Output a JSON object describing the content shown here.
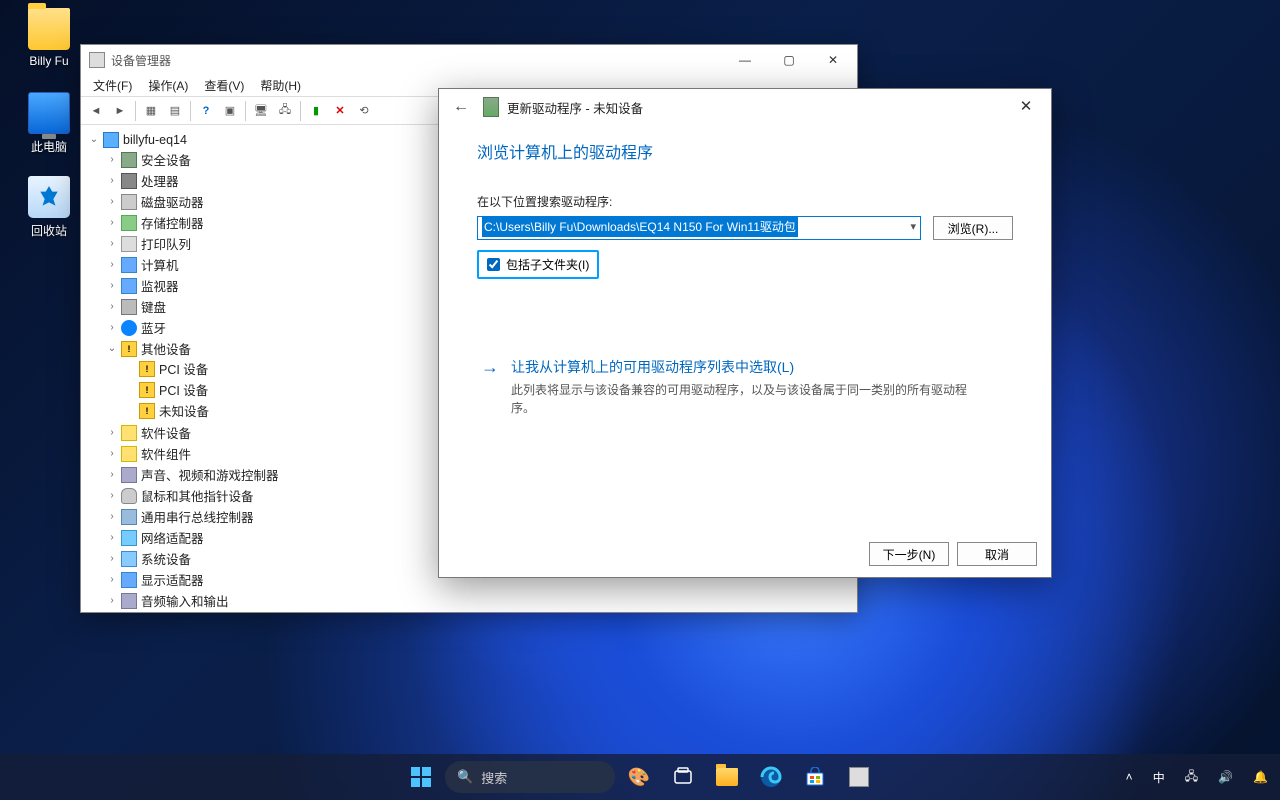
{
  "desktop": {
    "icons": [
      {
        "name": "user-folder",
        "label": "Billy Fu"
      },
      {
        "name": "this-pc",
        "label": "此电脑"
      },
      {
        "name": "recycle-bin",
        "label": "回收站"
      }
    ]
  },
  "devmgr": {
    "title": "设备管理器",
    "menu": [
      "文件(F)",
      "操作(A)",
      "查看(V)",
      "帮助(H)"
    ],
    "root": "billyfu-eq14",
    "nodes": [
      {
        "label": "安全设备",
        "icon": "i-sec"
      },
      {
        "label": "处理器",
        "icon": "i-chip"
      },
      {
        "label": "磁盘驱动器",
        "icon": "i-disk"
      },
      {
        "label": "存储控制器",
        "icon": "i-ctrl"
      },
      {
        "label": "打印队列",
        "icon": "i-print"
      },
      {
        "label": "计算机",
        "icon": "i-mon"
      },
      {
        "label": "监视器",
        "icon": "i-mon"
      },
      {
        "label": "键盘",
        "icon": "i-kb"
      },
      {
        "label": "蓝牙",
        "icon": "i-bt"
      },
      {
        "label": "其他设备",
        "icon": "i-warn",
        "open": true,
        "children": [
          {
            "label": "PCI 设备",
            "icon": "i-warn"
          },
          {
            "label": "PCI 设备",
            "icon": "i-warn"
          },
          {
            "label": "未知设备",
            "icon": "i-warn"
          }
        ]
      },
      {
        "label": "软件设备",
        "icon": "i-unk"
      },
      {
        "label": "软件组件",
        "icon": "i-unk"
      },
      {
        "label": "声音、视频和游戏控制器",
        "icon": "i-snd"
      },
      {
        "label": "鼠标和其他指针设备",
        "icon": "i-mouse"
      },
      {
        "label": "通用串行总线控制器",
        "icon": "i-usb"
      },
      {
        "label": "网络适配器",
        "icon": "i-net"
      },
      {
        "label": "系统设备",
        "icon": "i-sys"
      },
      {
        "label": "显示适配器",
        "icon": "i-mon"
      },
      {
        "label": "音频输入和输出",
        "icon": "i-snd"
      }
    ]
  },
  "wizard": {
    "title": "更新驱动程序 - 未知设备",
    "heading": "浏览计算机上的驱动程序",
    "search_label": "在以下位置搜索驱动程序:",
    "path": "C:\\Users\\Billy Fu\\Downloads\\EQ14 N150 For Win11驱动包",
    "browse_btn": "浏览(R)...",
    "include_sub": "包括子文件夹(I)",
    "pick_title": "让我从计算机上的可用驱动程序列表中选取(L)",
    "pick_desc": "此列表将显示与该设备兼容的可用驱动程序，以及与该设备属于同一类别的所有驱动程序。",
    "next_btn": "下一步(N)",
    "cancel_btn": "取消"
  },
  "taskbar": {
    "search_placeholder": "搜索",
    "ime": "中"
  }
}
